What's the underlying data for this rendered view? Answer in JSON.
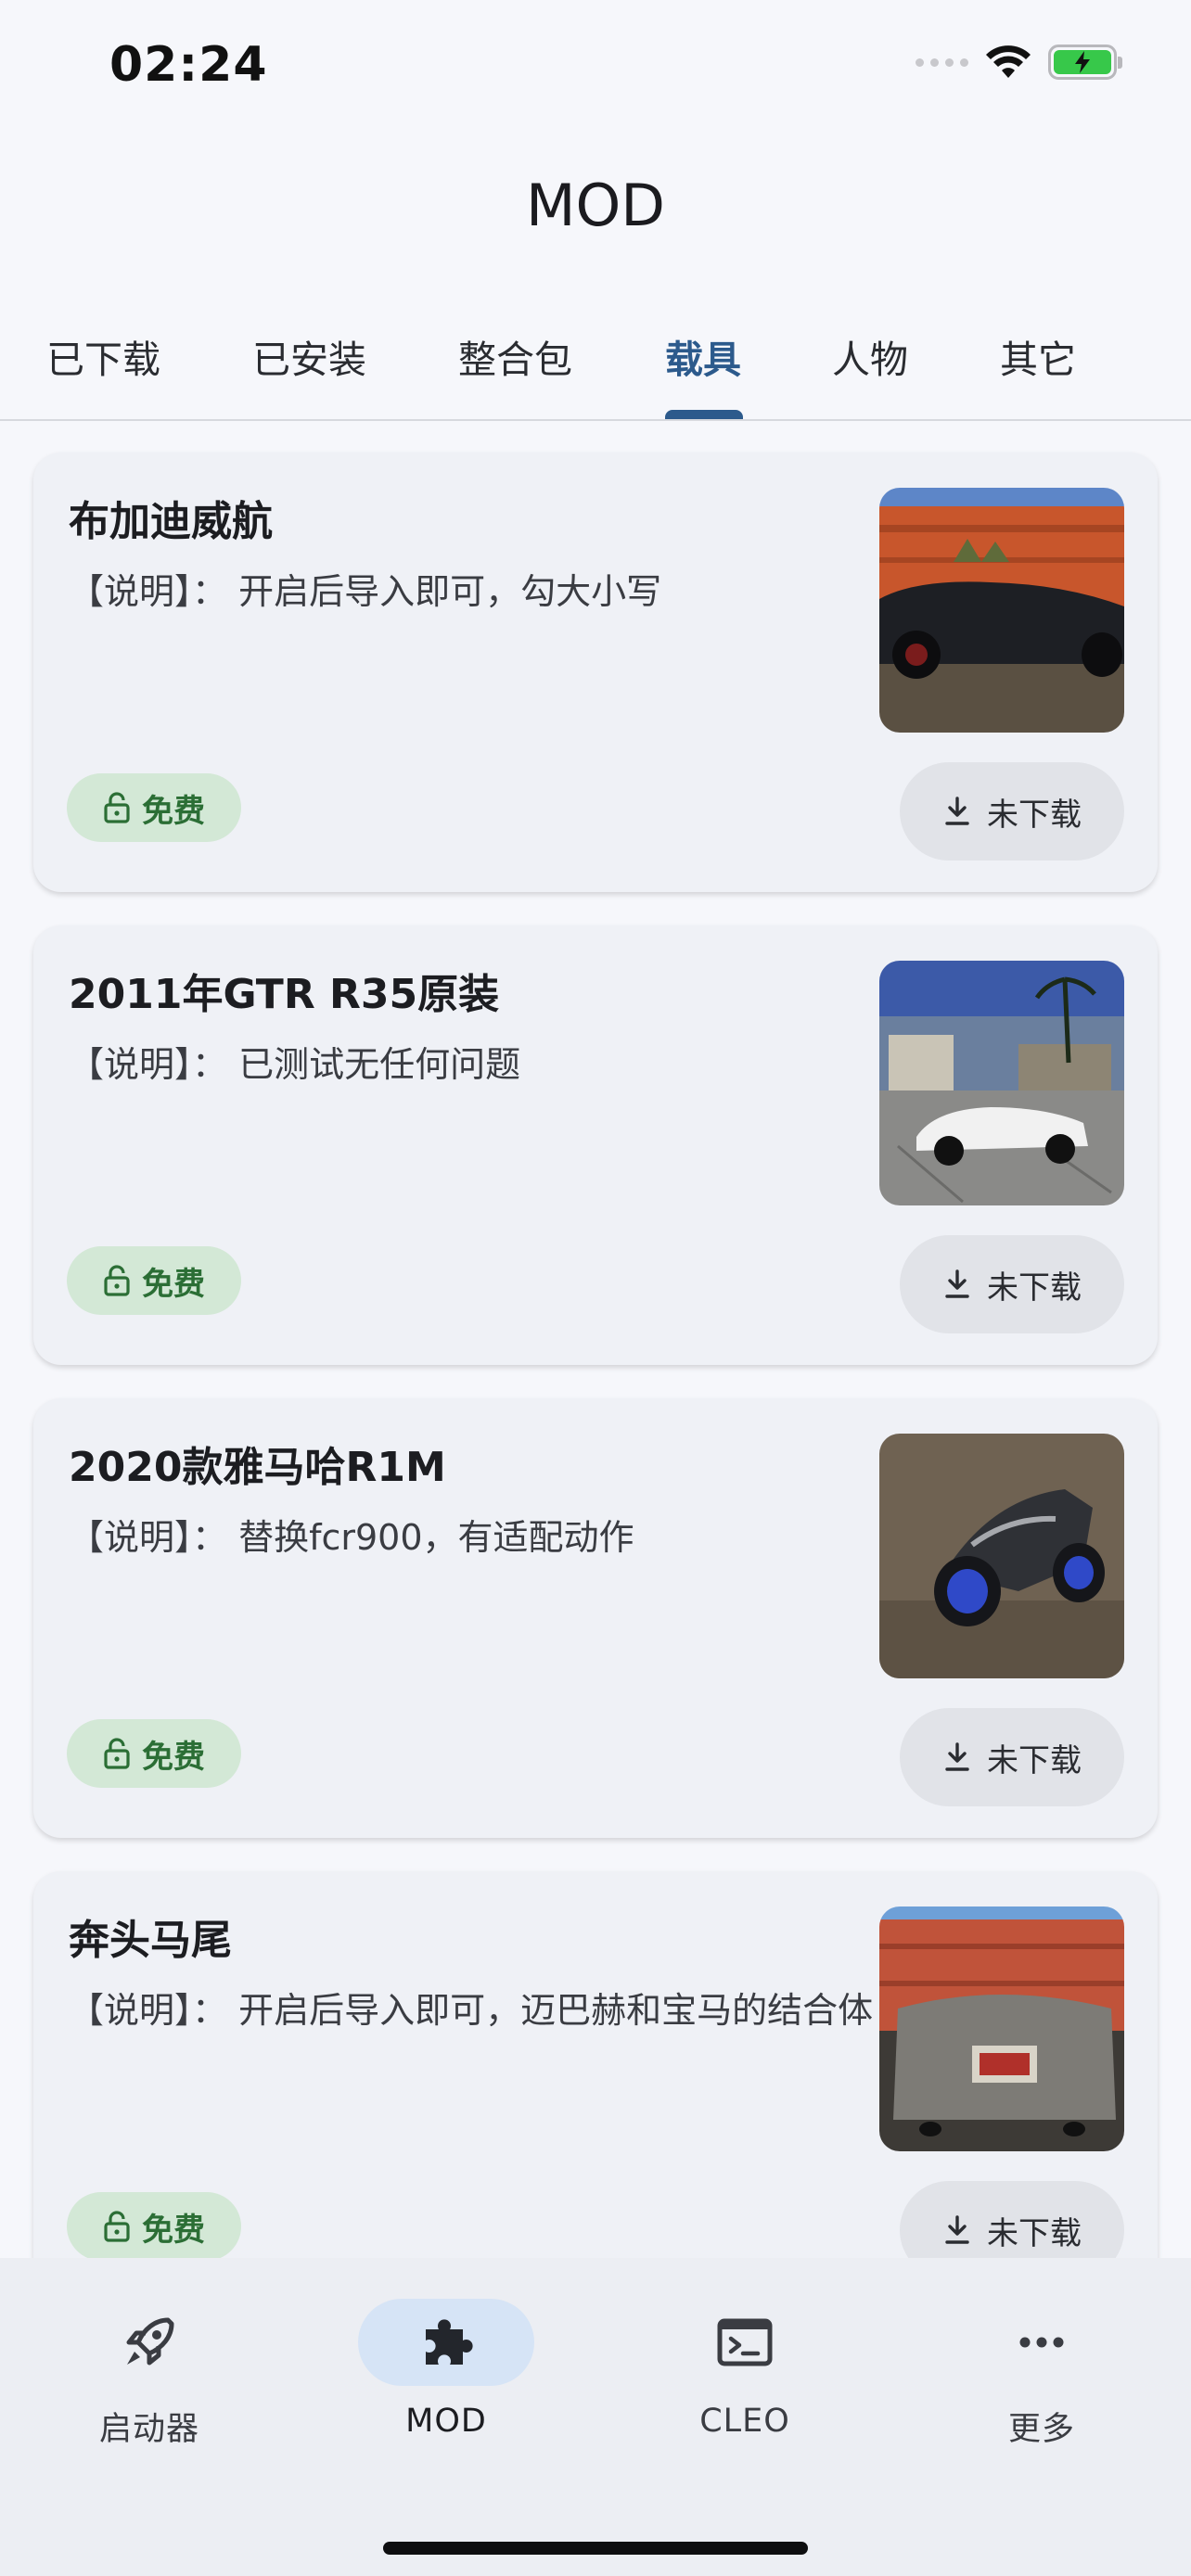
{
  "status_bar": {
    "time": "02:24",
    "icons": [
      "signal-icon",
      "wifi-icon",
      "battery-charging-icon"
    ]
  },
  "header": {
    "title": "MOD"
  },
  "tabs": [
    {
      "label": "已下载"
    },
    {
      "label": "已安装"
    },
    {
      "label": "整合包"
    },
    {
      "label": "载具",
      "active": true
    },
    {
      "label": "人物"
    },
    {
      "label": "其它"
    }
  ],
  "mods": [
    {
      "title": "布加迪威航",
      "description": "【说明】： 开启后导入即可，勾大小写",
      "badge": "免费",
      "download_label": "未下载"
    },
    {
      "title": "2011年GTR R35原装",
      "description": "【说明】： 已测试无任何问题",
      "badge": "免费",
      "download_label": "未下载"
    },
    {
      "title": "2020款雅马哈R1M",
      "description": "【说明】： 替换fcr900，有适配动作",
      "badge": "免费",
      "download_label": "未下载"
    },
    {
      "title": "奔头马尾",
      "description": "【说明】： 开启后导入即可，迈巴赫和宝马的结合体",
      "badge": "免费",
      "download_label": "未下载"
    }
  ],
  "bottom_nav": [
    {
      "label": "启动器",
      "icon": "rocket-icon"
    },
    {
      "label": "MOD",
      "icon": "puzzle-icon",
      "active": true
    },
    {
      "label": "CLEO",
      "icon": "terminal-icon"
    },
    {
      "label": "更多",
      "icon": "more-icon"
    }
  ],
  "colors": {
    "accent": "#2c5a8c",
    "badge_bg": "#d3e8d6",
    "badge_text": "#2b6e35",
    "card_bg": "#eff1f6",
    "page_bg": "#f6f7fb"
  }
}
